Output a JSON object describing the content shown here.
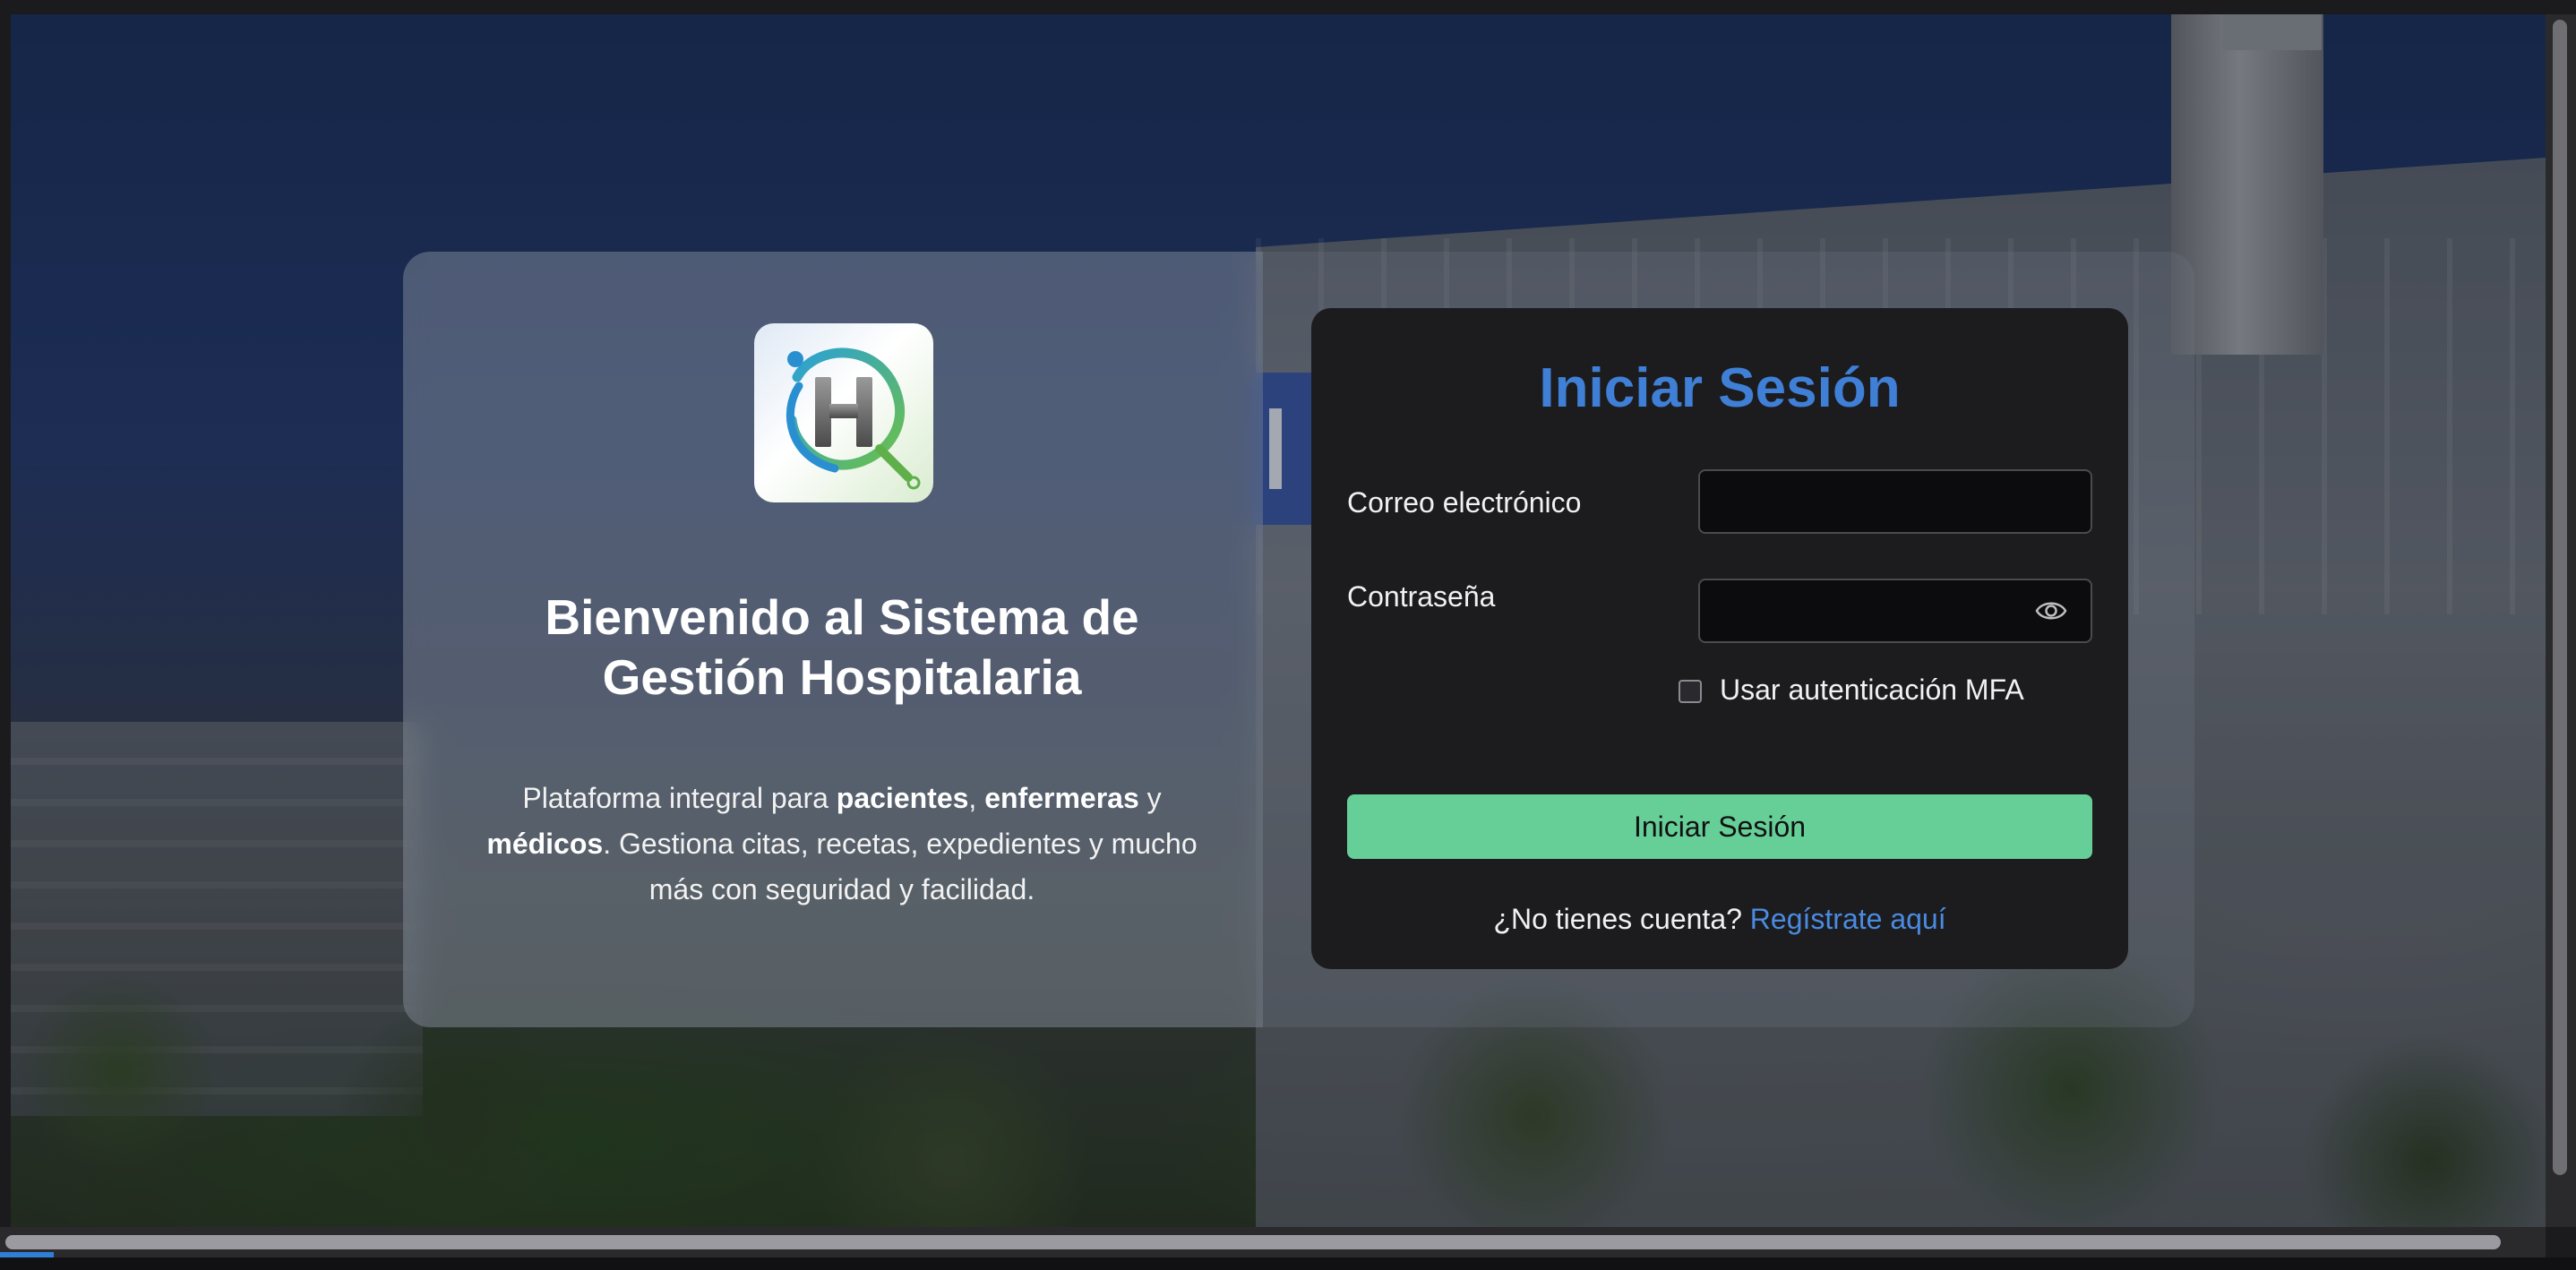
{
  "brand": {
    "logo_letter": "H",
    "colors": {
      "accent_blue": "#3f7fd6",
      "link_blue": "#4a8be0",
      "button_green": "#66cf98",
      "logo_green": "#5fb04a",
      "logo_teal": "#2aa0b8"
    }
  },
  "welcome": {
    "title": "Bienvenido al Sistema de Gestión Hospitalaria",
    "desc_part1": "Plataforma integral para ",
    "desc_bold1": "pacientes",
    "desc_sep1": ", ",
    "desc_bold2": "enfermeras",
    "desc_sep2": " y ",
    "desc_bold3": "médicos",
    "desc_part2": ". Gestiona citas, recetas, expedientes y mucho más con seguridad y facilidad."
  },
  "login": {
    "title": "Iniciar Sesión",
    "email_label": "Correo electrónico",
    "email_value": "",
    "password_label": "Contraseña",
    "password_value": "",
    "password_toggle_icon": "eye-icon",
    "mfa_label": "Usar autenticación MFA",
    "mfa_checked": false,
    "submit_label": "Iniciar Sesión",
    "register_prompt": "¿No tienes cuenta?",
    "register_link": "Regístrate aquí"
  }
}
